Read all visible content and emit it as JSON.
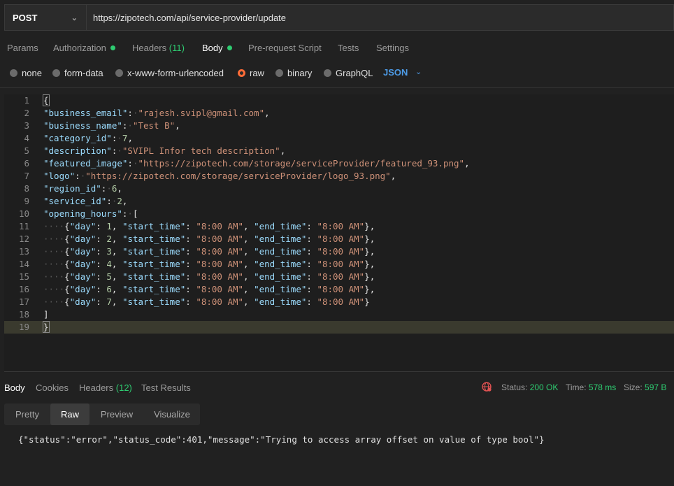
{
  "request": {
    "method": "POST",
    "url": "https://zipotech.com/api/service-provider/update"
  },
  "tabs": [
    {
      "label": "Params"
    },
    {
      "label": "Authorization"
    },
    {
      "label": "Headers",
      "count": "(11)"
    },
    {
      "label": "Body"
    },
    {
      "label": "Pre-request Script"
    },
    {
      "label": "Tests"
    },
    {
      "label": "Settings"
    }
  ],
  "body_types": [
    {
      "label": "none"
    },
    {
      "label": "form-data"
    },
    {
      "label": "x-www-form-urlencoded"
    },
    {
      "label": "raw"
    },
    {
      "label": "binary"
    },
    {
      "label": "GraphQL"
    }
  ],
  "body_format": "JSON",
  "editor": {
    "line_numbers": [
      "1",
      "2",
      "3",
      "4",
      "5",
      "6",
      "7",
      "8",
      "9",
      "10",
      "11",
      "12",
      "13",
      "14",
      "15",
      "16",
      "17",
      "18",
      "19"
    ],
    "fields": [
      {
        "key": "\"business_email\"",
        "value": "\"rajesh.svipl@gmail.com\""
      },
      {
        "key": "\"business_name\"",
        "value": "\"Test B\""
      },
      {
        "key": "\"category_id\"",
        "value": "7"
      },
      {
        "key": "\"description\"",
        "value": "\"SVIPL Infor tech description\""
      },
      {
        "key": "\"featured_image\"",
        "value": "\"https://zipotech.com/storage/serviceProvider/featured_93.png\""
      },
      {
        "key": "\"logo\"",
        "value": "\"https://zipotech.com/storage/serviceProvider/logo_93.png\""
      },
      {
        "key": "\"region_id\"",
        "value": "6"
      },
      {
        "key": "\"service_id\"",
        "value": "2"
      }
    ],
    "opening_hours_key": "\"opening_hours\"",
    "hours": [
      {
        "day": "1",
        "start": "\"8:00 AM\"",
        "end": "\"8:00 AM\""
      },
      {
        "day": "2",
        "start": "\"8:00 AM\"",
        "end": "\"8:00 AM\""
      },
      {
        "day": "3",
        "start": "\"8:00 AM\"",
        "end": "\"8:00 AM\""
      },
      {
        "day": "4",
        "start": "\"8:00 AM\"",
        "end": "\"8:00 AM\""
      },
      {
        "day": "5",
        "start": "\"8:00 AM\"",
        "end": "\"8:00 AM\""
      },
      {
        "day": "6",
        "start": "\"8:00 AM\"",
        "end": "\"8:00 AM\""
      },
      {
        "day": "7",
        "start": "\"8:00 AM\"",
        "end": "\"8:00 AM\""
      }
    ]
  },
  "response": {
    "tabs": [
      {
        "label": "Body"
      },
      {
        "label": "Cookies"
      },
      {
        "label": "Headers",
        "count": "(12)"
      },
      {
        "label": "Test Results"
      }
    ],
    "status_label": "Status:",
    "status_value": "200 OK",
    "time_label": "Time:",
    "time_value": "578 ms",
    "size_label": "Size:",
    "size_value": "597 B",
    "views": [
      "Pretty",
      "Raw",
      "Preview",
      "Visualize"
    ],
    "body": "{\"status\":\"error\",\"status_code\":401,\"message\":\"Trying to access array offset on value of type bool\"}"
  },
  "colors": {
    "accent": "#ff6c37",
    "ok": "#2ecc71",
    "link": "#4d9be6"
  }
}
